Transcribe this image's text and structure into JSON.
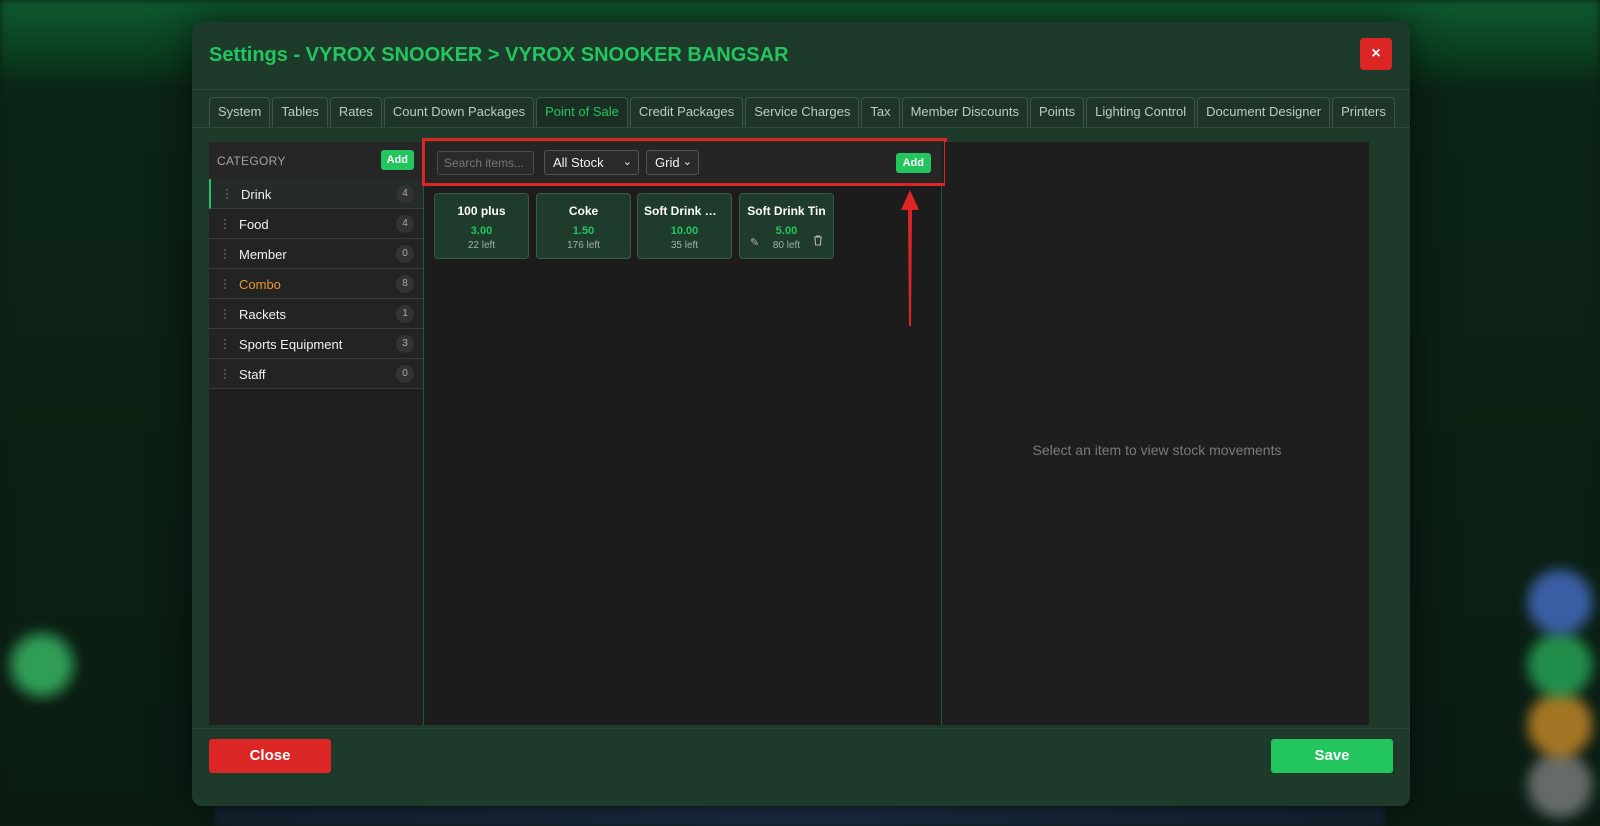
{
  "modal": {
    "title": "Settings - VYROX SNOOKER > VYROX SNOOKER BANGSAR",
    "close_icon": "×"
  },
  "tabs": [
    {
      "label": "System"
    },
    {
      "label": "Tables"
    },
    {
      "label": "Rates"
    },
    {
      "label": "Count Down Packages"
    },
    {
      "label": "Point of Sale",
      "active": true
    },
    {
      "label": "Credit Packages"
    },
    {
      "label": "Service Charges"
    },
    {
      "label": "Tax"
    },
    {
      "label": "Member Discounts"
    },
    {
      "label": "Points"
    },
    {
      "label": "Lighting Control"
    },
    {
      "label": "Document Designer"
    },
    {
      "label": "Printers"
    }
  ],
  "category": {
    "title": "CATEGORY",
    "add_label": "Add",
    "items": [
      {
        "label": "Drink",
        "count": "4"
      },
      {
        "label": "Food",
        "count": "4"
      },
      {
        "label": "Member",
        "count": "0"
      },
      {
        "label": "Combo",
        "count": "8"
      },
      {
        "label": "Rackets",
        "count": "1"
      },
      {
        "label": "Sports Equipment",
        "count": "3"
      },
      {
        "label": "Staff",
        "count": "0"
      }
    ]
  },
  "toolbar": {
    "search_placeholder": "Search items...",
    "stock_filter": "All Stock",
    "view_mode": "Grid",
    "add_label": "Add"
  },
  "items": [
    {
      "name": "100 plus",
      "price": "3.00",
      "stock": "22 left"
    },
    {
      "name": "Coke",
      "price": "1.50",
      "stock": "176 left"
    },
    {
      "name": "Soft Drink Bot...",
      "price": "10.00",
      "stock": "35 left"
    },
    {
      "name": "Soft Drink Tin",
      "price": "5.00",
      "stock": "80 left"
    }
  ],
  "detail": {
    "empty_message": "Select an item to view stock movements"
  },
  "footer": {
    "close_label": "Close",
    "save_label": "Save"
  },
  "colors": {
    "accent": "#22c55e",
    "danger": "#dc2626",
    "selected_category_text": "#e8962c"
  }
}
